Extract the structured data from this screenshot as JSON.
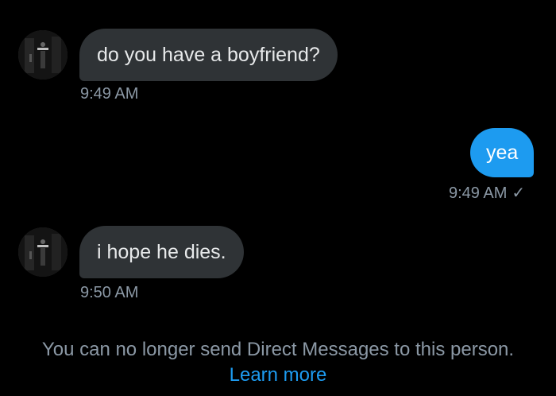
{
  "messages": [
    {
      "direction": "incoming",
      "text": "do you have a boyfriend?",
      "time": "9:49 AM"
    },
    {
      "direction": "outgoing",
      "text": "yea",
      "time": "9:49 AM",
      "status_icon": "check-icon"
    },
    {
      "direction": "incoming",
      "text": "i hope he dies.",
      "time": "9:50 AM"
    }
  ],
  "footer": {
    "notice": "You can no longer send Direct Messages to this person.",
    "link": "Learn more"
  },
  "colors": {
    "background": "#000000",
    "incoming_bubble": "#2f3336",
    "outgoing_bubble": "#1d9bf0",
    "timestamp": "#8b98a5",
    "link": "#1d9bf0"
  }
}
